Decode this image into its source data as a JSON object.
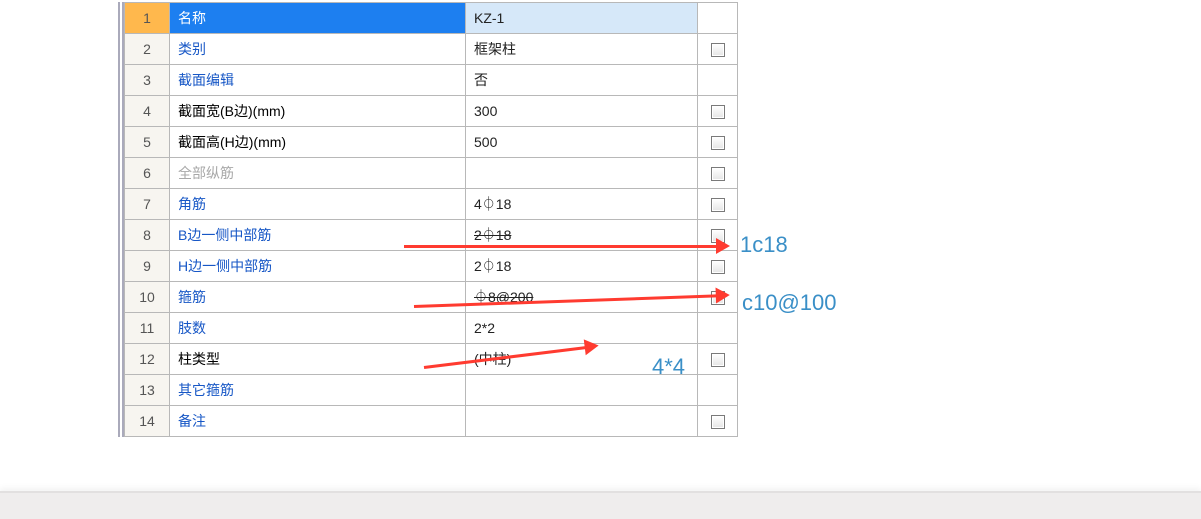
{
  "rows": [
    {
      "i": "1",
      "label": "名称",
      "value": "KZ-1",
      "labelStyle": "blue",
      "flag": false,
      "selected": true
    },
    {
      "i": "2",
      "label": "类别",
      "value": "框架柱",
      "labelStyle": "blue",
      "flag": true
    },
    {
      "i": "3",
      "label": "截面编辑",
      "value": "否",
      "labelStyle": "blue",
      "flag": false
    },
    {
      "i": "4",
      "label": "截面宽(B边)(mm)",
      "value": "300",
      "labelStyle": "",
      "flag": true
    },
    {
      "i": "5",
      "label": "截面高(H边)(mm)",
      "value": "500",
      "labelStyle": "",
      "flag": true
    },
    {
      "i": "6",
      "label": "全部纵筋",
      "value": "",
      "labelStyle": "grey",
      "flag": true
    },
    {
      "i": "7",
      "label": "角筋",
      "value": "4⏀18",
      "labelStyle": "blue",
      "flag": true
    },
    {
      "i": "8",
      "label": "B边一侧中部筋",
      "value": "2⏀18",
      "labelStyle": "blue",
      "flag": true,
      "struck": true
    },
    {
      "i": "9",
      "label": "H边一侧中部筋",
      "value": "2⏀18",
      "labelStyle": "blue",
      "flag": true
    },
    {
      "i": "10",
      "label": "箍筋",
      "value": "⏀8@200",
      "labelStyle": "blue",
      "flag": true,
      "struck": true
    },
    {
      "i": "11",
      "label": "肢数",
      "value": "2*2",
      "labelStyle": "blue",
      "flag": false
    },
    {
      "i": "12",
      "label": "柱类型",
      "value": "(中柱)",
      "labelStyle": "",
      "flag": true
    },
    {
      "i": "13",
      "label": "其它箍筋",
      "value": "",
      "labelStyle": "blue",
      "flag": false
    },
    {
      "i": "14",
      "label": "备注",
      "value": "",
      "labelStyle": "blue",
      "flag": true
    }
  ],
  "annotations": {
    "a8": "1c18",
    "a10": "c10@100",
    "a11": "4*4"
  }
}
